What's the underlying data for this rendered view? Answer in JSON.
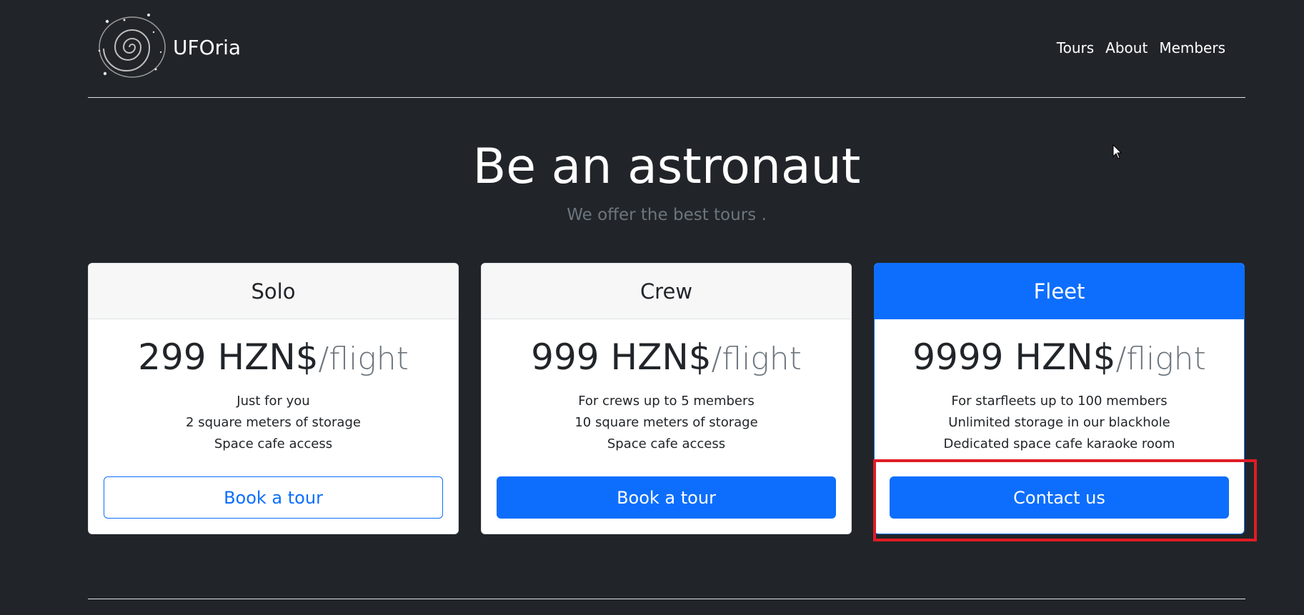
{
  "header": {
    "brand": "UFOria",
    "nav": [
      "Tours",
      "About",
      "Members"
    ]
  },
  "hero": {
    "title": "Be an astronaut",
    "subtitle": "We offer the best tours ."
  },
  "plans": [
    {
      "name": "Solo",
      "price": "299 HZN$",
      "per": "/flight",
      "features": [
        "Just for you",
        "2 square meters of storage",
        "Space cafe access"
      ],
      "button": "Book a tour"
    },
    {
      "name": "Crew",
      "price": "999 HZN$",
      "per": "/flight",
      "features": [
        "For crews up to 5 members",
        "10 square meters of storage",
        "Space cafe access"
      ],
      "button": "Book a tour"
    },
    {
      "name": "Fleet",
      "price": "9999 HZN$",
      "per": "/flight",
      "features": [
        "For starfleets up to 100 members",
        "Unlimited storage in our blackhole",
        "Dedicated space cafe karaoke room"
      ],
      "button": "Contact us"
    }
  ],
  "colors": {
    "background": "#212529",
    "primary": "#0d6efd",
    "muted": "#6c757d",
    "highlight": "#e01b24"
  },
  "icons": {
    "logo": "spiral-galaxy-logo",
    "cursor": "mouse-pointer"
  }
}
